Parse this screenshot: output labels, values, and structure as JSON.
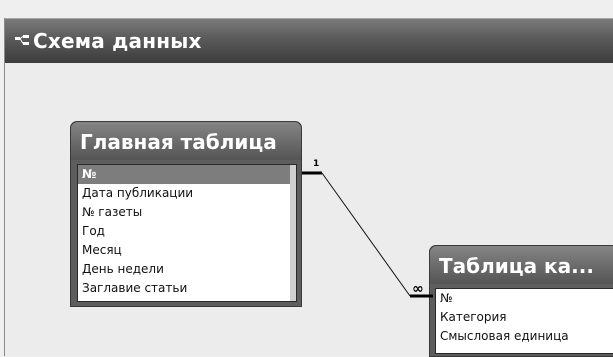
{
  "window": {
    "title": "Схема данных"
  },
  "tables": {
    "main": {
      "title": "Главная таблица",
      "fields": [
        "№",
        "Дата публикации",
        "№ газеты",
        "Год",
        "Месяц",
        "День недели",
        "Заглавие статьи"
      ],
      "selected_field": "№"
    },
    "category": {
      "title": "Таблица ка...",
      "fields": [
        "№",
        "Категория",
        "Смысловая единица"
      ]
    }
  },
  "relationship": {
    "one_label": "1",
    "many_label": "∞"
  }
}
